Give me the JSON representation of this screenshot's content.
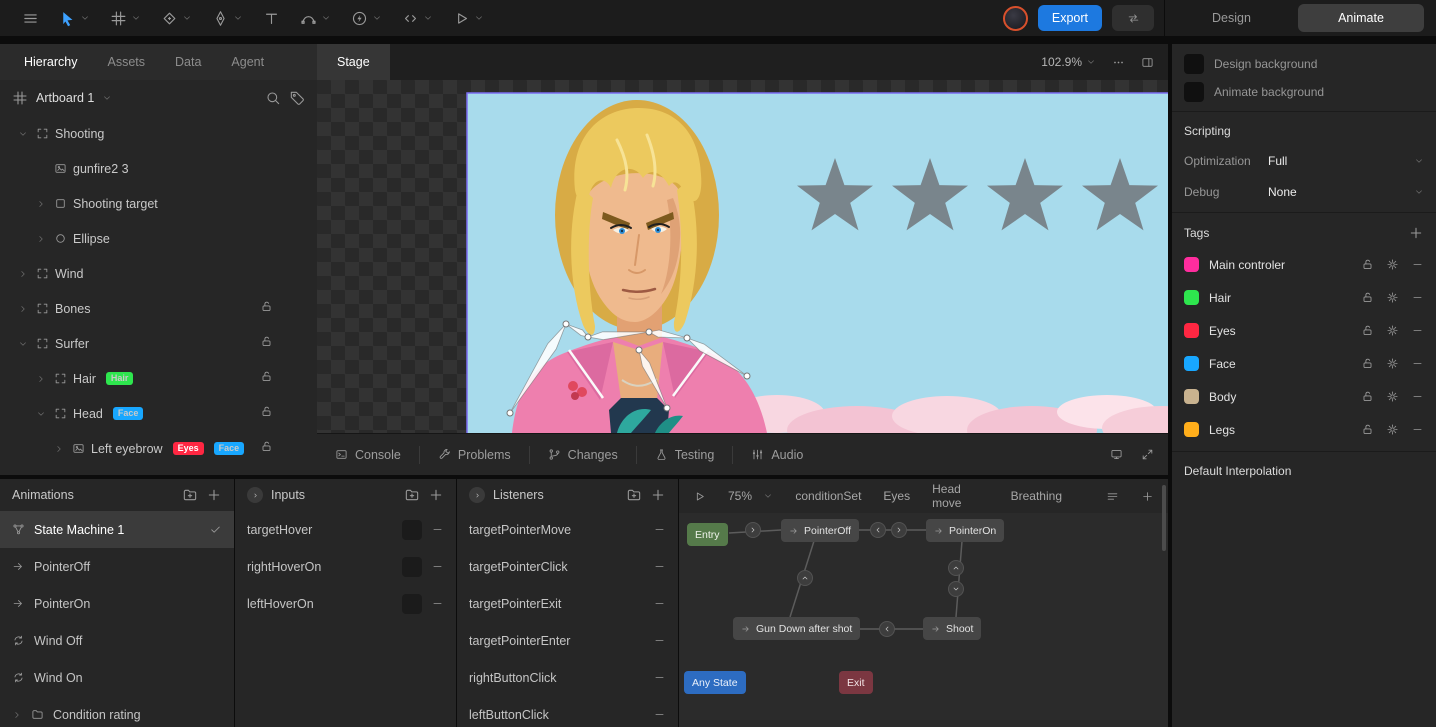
{
  "colors": {
    "accent_blue": "#1d79e0",
    "selection_purple": "#7b6df2",
    "sky": "#a8dbec",
    "node_entry": "#557a4a",
    "node_any": "#2d6cc1",
    "node_exit": "#7b3741",
    "node_state": "#464646"
  },
  "topbar": {
    "export_label": "Export",
    "design_label": "Design",
    "animate_label": "Animate",
    "tools": [
      "menu-icon",
      "cursor-icon",
      "artboard-icon",
      "transform-icon",
      "pen-icon",
      "text-icon",
      "curve-icon",
      "bolt-icon",
      "code-icon",
      "play-icon"
    ]
  },
  "left_panel": {
    "tabs": [
      "Hierarchy",
      "Assets",
      "Data",
      "Agent"
    ],
    "active_tab": "Hierarchy",
    "artboard": "Artboard 1",
    "tree": [
      {
        "label": "Shooting"
      },
      {
        "label": "gunfire2 3"
      },
      {
        "label": "Shooting target"
      },
      {
        "label": "Ellipse"
      },
      {
        "label": "Wind"
      },
      {
        "label": "Bones",
        "locked": true
      },
      {
        "label": "Surfer",
        "locked": true
      },
      {
        "label": "Hair",
        "locked": true,
        "tags": [
          {
            "label": "Hair",
            "color": "#2ee64e",
            "fg": "#10300f"
          }
        ]
      },
      {
        "label": "Head",
        "locked": true,
        "tags": [
          {
            "label": "Face",
            "color": "#18a7ff",
            "fg": "#06253d"
          }
        ]
      },
      {
        "label": "Left eyebrow",
        "locked": true,
        "tags": [
          {
            "label": "Eyes",
            "color": "#ff2742",
            "fg": "#ffffff"
          },
          {
            "label": "Face",
            "color": "#18a7ff",
            "fg": "#06253d"
          }
        ]
      }
    ]
  },
  "stage": {
    "tab": "Stage",
    "zoom": "102.9%"
  },
  "console": {
    "tabs": [
      {
        "label": "Console",
        "icon": "terminal-icon"
      },
      {
        "label": "Problems",
        "icon": "wrench-icon"
      },
      {
        "label": "Changes",
        "icon": "branch-icon"
      },
      {
        "label": "Testing",
        "icon": "flask-icon"
      },
      {
        "label": "Audio",
        "icon": "audio-icon"
      }
    ]
  },
  "animations": {
    "title": "Animations",
    "items": [
      {
        "label": "State Machine 1",
        "icon": "state-machine-icon",
        "selected": true
      },
      {
        "label": "PointerOff",
        "icon": "one-shot-icon"
      },
      {
        "label": "PointerOn",
        "icon": "one-shot-icon"
      },
      {
        "label": "Wind Off",
        "icon": "loop-icon"
      },
      {
        "label": "Wind On",
        "icon": "loop-icon"
      },
      {
        "label": "Condition rating",
        "icon": "folder-icon"
      }
    ]
  },
  "inputs": {
    "title": "Inputs",
    "items": [
      {
        "label": "targetHover"
      },
      {
        "label": "rightHoverOn"
      },
      {
        "label": "leftHoverOn"
      }
    ]
  },
  "listeners": {
    "title": "Listeners",
    "items": [
      {
        "label": "targetPointerMove"
      },
      {
        "label": "targetPointerClick"
      },
      {
        "label": "targetPointerExit"
      },
      {
        "label": "targetPointerEnter"
      },
      {
        "label": "rightButtonClick"
      },
      {
        "label": "leftButtonClick"
      }
    ]
  },
  "state_machine": {
    "zoom": "75%",
    "layers": [
      "conditionSet",
      "Eyes",
      "Head move",
      "Breathing"
    ],
    "nodes": [
      {
        "label": "Entry",
        "type": "entry",
        "color": "#557a4a"
      },
      {
        "label": "PointerOff",
        "type": "state",
        "color": "#464646"
      },
      {
        "label": "PointerOn",
        "type": "state",
        "color": "#464646"
      },
      {
        "label": "Gun Down after shot",
        "type": "state",
        "color": "#464646"
      },
      {
        "label": "Shoot",
        "type": "state",
        "color": "#464646"
      },
      {
        "label": "Any State",
        "type": "any",
        "color": "#2d6cc1"
      },
      {
        "label": "Exit",
        "type": "exit",
        "color": "#7b3741"
      }
    ]
  },
  "inspector": {
    "background_rows": [
      "Design background",
      "Animate background"
    ],
    "scripting_title": "Scripting",
    "optimization_label": "Optimization",
    "optimization_value": "Full",
    "debug_label": "Debug",
    "debug_value": "None",
    "tags_title": "Tags",
    "tags": [
      {
        "label": "Main controler",
        "color": "#ff2d9e"
      },
      {
        "label": "Hair",
        "color": "#2ee64e"
      },
      {
        "label": "Eyes",
        "color": "#ff2742"
      },
      {
        "label": "Face",
        "color": "#18a7ff"
      },
      {
        "label": "Body",
        "color": "#c8b28f"
      },
      {
        "label": "Legs",
        "color": "#ffae1b"
      }
    ],
    "default_interpolation_title": "Default Interpolation"
  }
}
